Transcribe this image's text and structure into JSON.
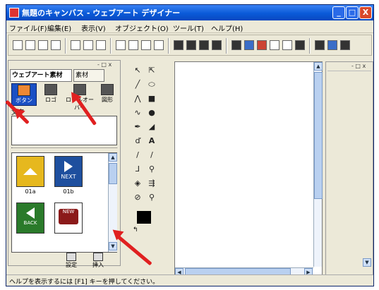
{
  "window": {
    "title": "無題のキャンバス - ウェブアート デザイナー",
    "buttons": {
      "minimize": "_",
      "maximize": "□",
      "close": "X"
    }
  },
  "menu": [
    "ファイル(F)",
    "編集(E)",
    "表示(V)",
    "オブジェクト(O)",
    "ツール(T)",
    "ヘルプ(H)"
  ],
  "left_panel": {
    "header_controls": "- □ x",
    "tabs": [
      "ウェブアート素材",
      "素材"
    ],
    "categories": [
      "ボタン",
      "ロゴ",
      "ロールオーバー",
      "図形"
    ],
    "text_label": "文字",
    "thumbnails": [
      {
        "caption": "01a",
        "label": "",
        "color": "#e6b81e"
      },
      {
        "caption": "01b",
        "label": "NEXT",
        "color": "#1e4f9e"
      },
      {
        "caption": "",
        "label": "BACK",
        "color": "#2a7a2a"
      },
      {
        "caption": "",
        "label": "NEW",
        "color": "#8b1a1a"
      }
    ],
    "bottom_buttons": [
      "設定",
      "挿入"
    ]
  },
  "right_panel": {
    "header_controls": "- □ x"
  },
  "status": {
    "text": "ヘルプを表示するには [F1] キーを押してください。"
  },
  "colors": {
    "titlebar": "#0a5ad8",
    "annotation_arrow": "#e02020",
    "selected": "#1a4fc4"
  }
}
